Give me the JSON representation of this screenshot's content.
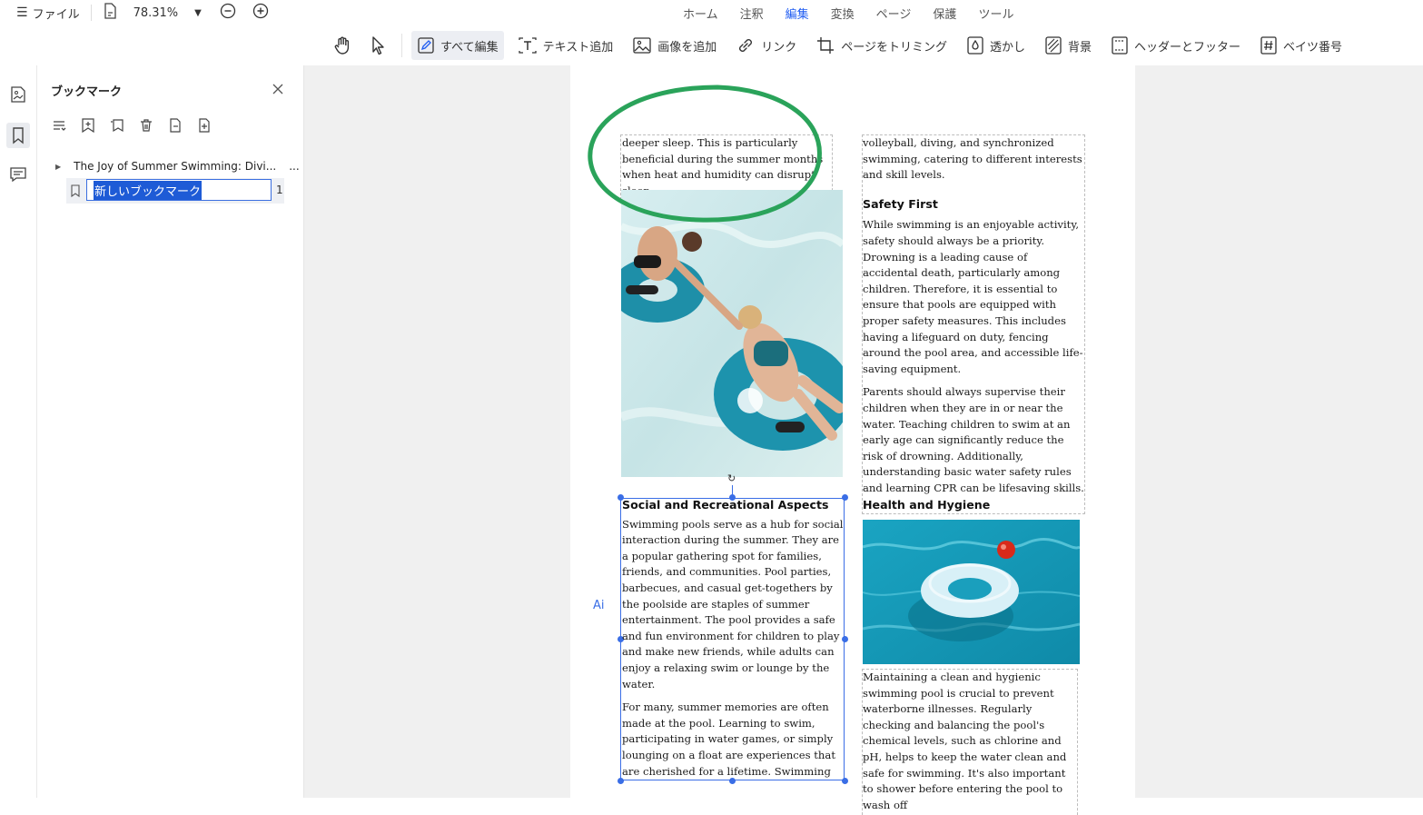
{
  "topbar": {
    "menu_label": "ファイル",
    "zoom": "78.31%",
    "tabs": [
      {
        "label": "ホーム",
        "active": false
      },
      {
        "label": "注釈",
        "active": false
      },
      {
        "label": "編集",
        "active": true
      },
      {
        "label": "変換",
        "active": false
      },
      {
        "label": "ページ",
        "active": false
      },
      {
        "label": "保護",
        "active": false
      },
      {
        "label": "ツール",
        "active": false
      }
    ]
  },
  "toolbar": {
    "edit_all": "すべて編集",
    "add_text": "テキスト追加",
    "add_image": "画像を追加",
    "link": "リンク",
    "crop": "ページをトリミング",
    "watermark": "透かし",
    "background": "背景",
    "header_footer": "ヘッダーとフッター",
    "bates": "ベイツ番号"
  },
  "panel": {
    "title": "ブックマーク",
    "bookmarks": [
      {
        "label": "The Joy of Summer Swimming: Divi...",
        "more": "..."
      }
    ],
    "new_bookmark": {
      "value": "新しいブックマーク",
      "page": "1"
    }
  },
  "document": {
    "left_top": "deeper sleep. This is particularly beneficial during the summer months when heat and humidity can disrupt sleep.",
    "social_heading": "Social and Recreational Aspects",
    "social_p1": "Swimming pools serve as a hub for social interaction during the summer. They are a popular gathering spot for families, friends, and communities. Pool parties, barbecues, and casual get-togethers by the poolside are staples of summer entertainment. The pool provides a safe and fun environment for children to play and make new friends, while adults can enjoy a relaxing swim or lounge by the water.",
    "social_p2": "For many, summer memories are often made at the pool. Learning to swim, participating in water games, or simply lounging on a float are experiences that are cherished for a lifetime. Swimming pools also offer a variety of recreational activities such as water",
    "right_top": "volleyball, diving, and synchronized swimming, catering to different interests and skill levels.",
    "safety_heading": "Safety First",
    "safety_p1": "While swimming is an enjoyable activity, safety should always be a priority. Drowning is a leading cause of accidental death, particularly among children. Therefore, it is essential to ensure that pools are equipped with proper safety measures. This includes having a lifeguard on duty, fencing around the pool area, and accessible life-saving equipment.",
    "safety_p2": "Parents should always supervise their children when they are in or near the water. Teaching children to swim at an early age can significantly reduce the risk of drowning. Additionally, understanding basic water safety rules and learning CPR can be lifesaving skills.",
    "health_heading": "Health and Hygiene",
    "health_p1": "Maintaining a clean and hygienic swimming pool is crucial to prevent waterborne illnesses. Regularly checking and balancing the pool's chemical levels, such as chlorine and pH, helps to keep the water clean and safe for swimming. It's also important to shower before entering the pool to wash off",
    "ai_badge": "Ai"
  },
  "colors": {
    "accent": "#1f5cf2",
    "annotation_circle": "#2aa35a",
    "pool_water": "#27a7c4"
  }
}
